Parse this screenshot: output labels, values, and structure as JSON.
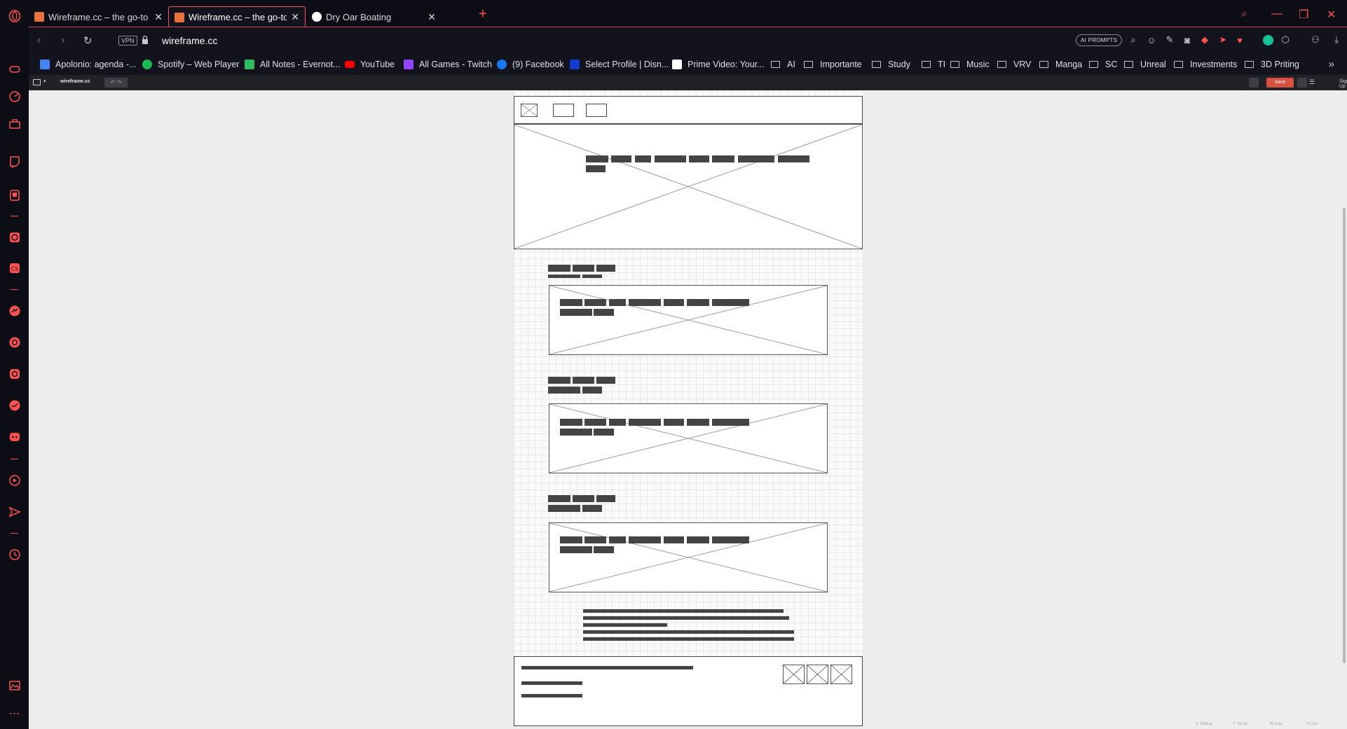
{
  "tabs": [
    {
      "title": "Wireframe.cc – the go-to fr",
      "favicon_color": "#e8743b",
      "active": false
    },
    {
      "title": "Wireframe.cc – the go-to fr",
      "favicon_color": "#e8743b",
      "active": true
    },
    {
      "title": "Dry Oar Boating",
      "favicon_color": "#ffffff",
      "active": false
    }
  ],
  "address": {
    "vpn_label": "VPN",
    "url": "wireframe.cc",
    "ai_prompts_label": "AI PROMPTS"
  },
  "bookmarks": [
    {
      "label": "Apolonio: agenda -...",
      "icon": "calendar-icon",
      "color": "#4285f4"
    },
    {
      "label": "Spotify – Web Player",
      "icon": "spotify-icon",
      "color": "#1db954"
    },
    {
      "label": "All Notes - Evernot...",
      "icon": "evernote-icon",
      "color": "#2dbe60"
    },
    {
      "label": "YouTube",
      "icon": "youtube-icon",
      "color": "#ff0000"
    },
    {
      "label": "All Games - Twitch",
      "icon": "twitch-icon",
      "color": "#9146ff"
    },
    {
      "label": "(9) Facebook",
      "icon": "facebook-icon",
      "color": "#1877f2"
    },
    {
      "label": "Select Profile | Disn...",
      "icon": "disney-icon",
      "color": "#113ccf"
    },
    {
      "label": "Prime Video: Your...",
      "icon": "amazon-icon",
      "color": "#ffffff"
    },
    {
      "label": "AI",
      "icon": "folder-icon"
    },
    {
      "label": "Importante",
      "icon": "folder-icon"
    },
    {
      "label": "Study",
      "icon": "folder-icon"
    },
    {
      "label": "TI",
      "icon": "folder-icon"
    },
    {
      "label": "Music",
      "icon": "folder-icon"
    },
    {
      "label": "VRV",
      "icon": "folder-icon"
    },
    {
      "label": "Manga",
      "icon": "folder-icon"
    },
    {
      "label": "SC",
      "icon": "folder-icon"
    },
    {
      "label": "Unreal",
      "icon": "folder-icon"
    },
    {
      "label": "Investments",
      "icon": "folder-icon"
    },
    {
      "label": "3D Priting",
      "icon": "folder-icon"
    }
  ],
  "wireframe_app": {
    "logo": "wireframe.cc",
    "undo_redo": "↶ ↷",
    "save_label": "Save",
    "signup_label": "Sign Up",
    "coords": [
      "X: 1098 px",
      "Y: 122 px",
      "W: 0 px",
      "H: 0 px"
    ]
  },
  "colors": {
    "accent": "#ff5252",
    "chrome_bg": "#0d0e15",
    "toolbar_bg": "#12131c",
    "save": "#d9503f"
  }
}
